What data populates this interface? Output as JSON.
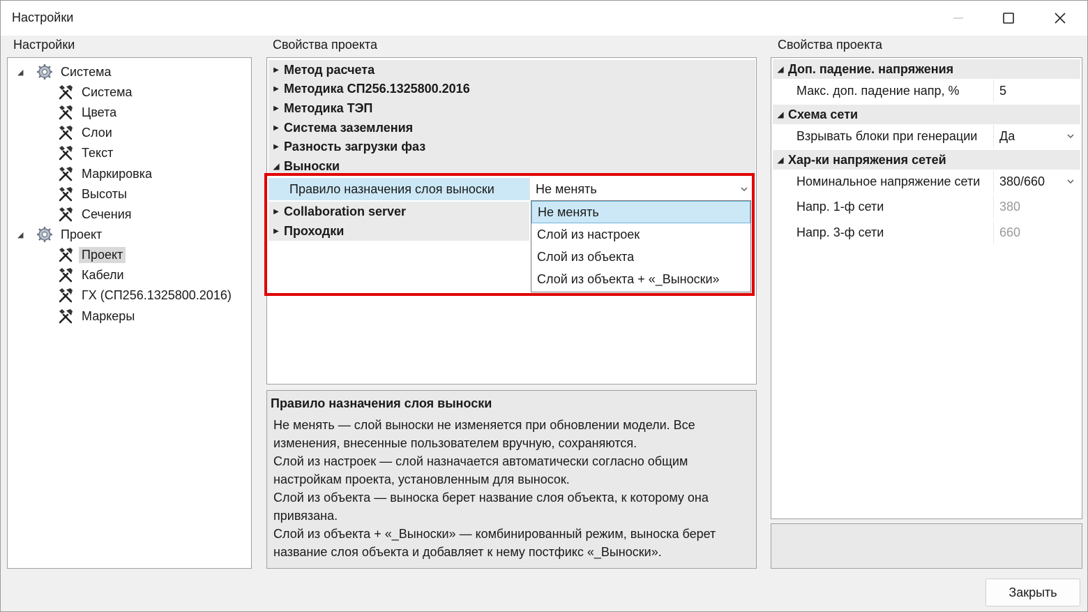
{
  "window": {
    "title": "Настройки"
  },
  "left": {
    "group_label": "Настройки",
    "tree": [
      {
        "label": "Система",
        "kind": "gear-icon",
        "level": 0
      },
      {
        "label": "Система",
        "kind": "tools-icon",
        "level": 1
      },
      {
        "label": "Цвета",
        "kind": "tools-icon",
        "level": 1
      },
      {
        "label": "Слои",
        "kind": "tools-icon",
        "level": 1
      },
      {
        "label": "Текст",
        "kind": "tools-icon",
        "level": 1
      },
      {
        "label": "Маркировка",
        "kind": "tools-icon",
        "level": 1
      },
      {
        "label": "Высоты",
        "kind": "tools-icon",
        "level": 1
      },
      {
        "label": "Сечения",
        "kind": "tools-icon",
        "level": 1
      },
      {
        "label": "Проект",
        "kind": "gear-icon",
        "level": 0
      },
      {
        "label": "Проект",
        "kind": "tools-icon",
        "level": 1,
        "selected": true
      },
      {
        "label": "Кабели",
        "kind": "tools-icon",
        "level": 1
      },
      {
        "label": "ГХ (СП256.1325800.2016)",
        "kind": "tools-icon",
        "level": 1
      },
      {
        "label": "Маркеры",
        "kind": "tools-icon",
        "level": 1
      }
    ]
  },
  "middle": {
    "group_label": "Свойства проекта",
    "categories": [
      "Метод расчета",
      "Методика СП256.1325800.2016",
      "Методика ТЭП",
      "Система заземления",
      "Разность загрузки фаз",
      "Выноски"
    ],
    "selected_property": {
      "name": "Правило назначения слоя выноски",
      "value": "Не менять"
    },
    "categories_after": [
      "Collaboration server",
      "Проходки"
    ],
    "dropdown_options": [
      "Не менять",
      "Слой из настроек",
      "Слой из объекта",
      "Слой из объекта + «_Выноски»"
    ],
    "description": {
      "title": "Правило назначения слоя выноски",
      "text": "Не менять — слой выноски не изменяется при обновлении модели. Все\nизменения, внесенные пользователем вручную, сохраняются.\nСлой из настроек — слой назначается автоматически согласно общим\nнастройкам проекта, установленным для выносок.\nСлой из объекта — выноска берет название слоя объекта, к которому она\nпривязана.\nСлой из объекта + «_Выноски» — комбинированный режим, выноска берет\nназвание слоя объекта и добавляет к нему постфикс «_Выноски»."
    }
  },
  "right": {
    "group_label": "Свойства проекта",
    "cat1": "Доп. падение. напряжения",
    "p1": {
      "name": "Макс. доп. падение напр, %",
      "value": "5"
    },
    "cat2": "Схема сети",
    "p2": {
      "name": "Взрывать блоки при генерации",
      "value": "Да"
    },
    "cat3": "Хар-ки напряжения сетей",
    "p3": {
      "name": "Номинальное напряжение сети",
      "value": "380/660"
    },
    "p4": {
      "name": "Напр. 1-ф сети",
      "value": "380"
    },
    "p5": {
      "name": "Напр. 3-ф сети",
      "value": "660"
    }
  },
  "buttons": {
    "close": "Закрыть"
  },
  "colors": {
    "highlight": "#e00000",
    "selection": "#cce8f6"
  }
}
